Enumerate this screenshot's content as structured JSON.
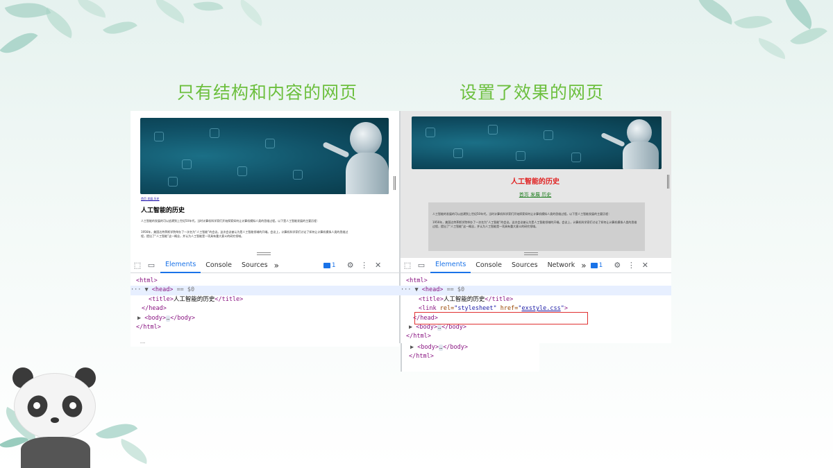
{
  "headings": {
    "left": "只有结构和内容的网页",
    "right": "设置了效果的网页"
  },
  "left_page": {
    "nav_links": "首页 发展 历史",
    "title": "人工智能的历史",
    "para1": "人工智能的发展的可以追溯到上世纪50年代。当时计算机科学家们开始探索如何让计算机模拟人类的思维过程。以下是人工智能发展的主要历程：",
    "para2": "1956年，美国达特茅斯学院举办了一次名为“人工智能”的会议。这次会议被认为是人工智能领域的开端。会议上，计算机科学家们讨论了如何让计算机模拟人类的思维过程，提出了“人工智能”这一概念，并认为人工智能是一项具有重大意义的研究领域。"
  },
  "right_page": {
    "title": "人工智能的历史",
    "nav_links": "首页 发展 历史",
    "para1": "人工智能的发展的可以追溯到上世纪50年代。当时计算机科学家们开始探索如何让计算机模拟人类的思维过程。以下是人工智能发展的主要历程：",
    "para2": "1956年，美国达特茅斯学院举办了一次名为“人工智能”的会议。这次会议被认为是人工智能领域的开端。会议上，计算机科学家们讨论了如何让计算机模拟人类的思维过程，提出了“人工智能”这一概念，并认为人工智能是一项具有重大意义的研究领域。",
    "title_color": "#e02020",
    "link_color": "#1e7d1e"
  },
  "devtools_left": {
    "tabs": [
      "Elements",
      "Console",
      "Sources"
    ],
    "more": "»",
    "badge_count": "1",
    "lines": {
      "html_open": "<html>",
      "head_open": "<head>",
      "head_eq": "== $0",
      "title_open": "<title>",
      "title_text": "人工智能的历史",
      "title_close": "</title>",
      "head_close": "</head>",
      "body_open": "<body>",
      "ellipsis": "…",
      "body_close": "</body>",
      "html_close": "</html>",
      "trail": "……"
    }
  },
  "devtools_right": {
    "tabs": [
      "Elements",
      "Console",
      "Sources",
      "Network"
    ],
    "more": "»",
    "badge_count": "1",
    "lines": {
      "html_open": "<html>",
      "head_open": "<head>",
      "head_eq": "== $0",
      "title_open": "<title>",
      "title_text": "人工智能的历史",
      "title_close": "</title>",
      "link_open": "<link ",
      "rel_attr": "rel=",
      "rel_val": "\"stylesheet\"",
      "href_attr": " href=",
      "href_q1": "\"",
      "href_val": "exstyle.css",
      "href_q2": "\"",
      "link_close": ">",
      "head_close": "</head>",
      "body_open": "<body>",
      "ellipsis": "…",
      "body_close": "</body>",
      "html_close": "</html>",
      "body_open_2": "<body>",
      "body_close_2": "</body>",
      "html_close_2": "</html>"
    },
    "highlight_color": "#e03030"
  }
}
